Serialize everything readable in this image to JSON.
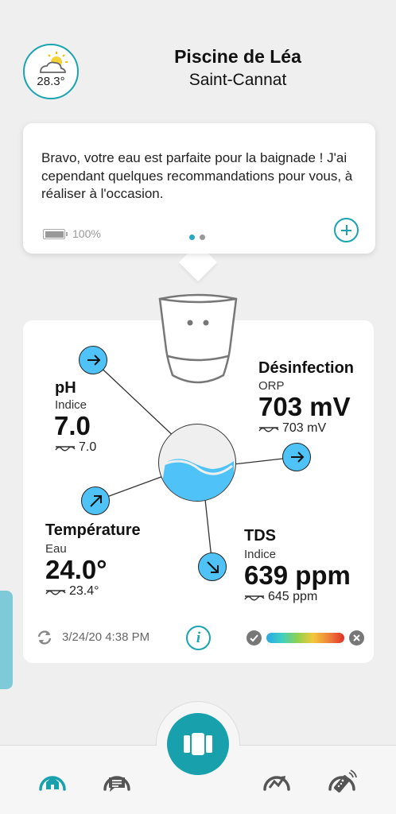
{
  "header": {
    "weather_temp": "28.3°",
    "pool_name": "Piscine de Léa",
    "location": "Saint-Cannat"
  },
  "message": {
    "text": "Bravo, votre eau est parfaite pour la baignade ! J'ai cependant quelques recommandations pour vous, à réaliser à l'occasion.",
    "battery": "100%",
    "battery_level": 1.0,
    "page_dots": 2,
    "active_dot": 0
  },
  "measures": {
    "ph": {
      "title": "pH",
      "sub": "Indice",
      "value": "7.0",
      "ref": "7.0"
    },
    "disinfection": {
      "title": "Désinfection",
      "sub": "ORP",
      "value": "703 mV",
      "ref": "703 mV"
    },
    "temperature": {
      "title": "Température",
      "sub": "Eau",
      "value": "24.0°",
      "ref": "23.4°"
    },
    "tds": {
      "title": "TDS",
      "sub": "Indice",
      "value": "639 ppm",
      "ref": "645 ppm"
    }
  },
  "footer": {
    "date": "3/24/20 4:38 PM"
  },
  "colors": {
    "accent": "#18a0ad",
    "arrow_button": "#4fc3f7",
    "water": "#4fc3f7"
  },
  "nav": {
    "items": [
      "home-icon",
      "chat-icon",
      "device-icon",
      "stats-icon",
      "remote-icon"
    ],
    "active": "home-icon"
  }
}
